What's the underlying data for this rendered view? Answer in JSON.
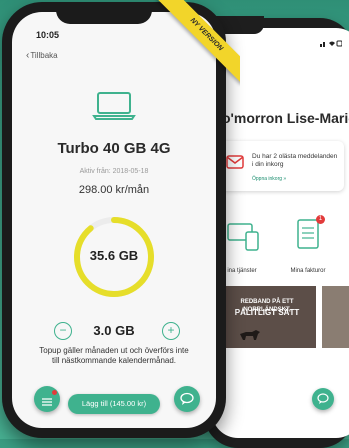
{
  "colors": {
    "accent": "#3fb28e",
    "gauge_track": "#ececec",
    "gauge_fill": "#e6de2a",
    "ribbon": "#f2d52a",
    "alert": "#e23b3b"
  },
  "ribbon": {
    "label": "NY VERSION"
  },
  "front": {
    "status_time": "10:05",
    "back_label": "Tillbaka",
    "plan_icon": "laptop-icon",
    "plan_title": "Turbo 40 GB 4G",
    "active_from": "Aktiv från: 2018-05-18",
    "price": "298.00 kr/mån",
    "gauge": {
      "value_label": "35.6 GB",
      "fill_fraction": 0.89
    },
    "stepper": {
      "minus": "−",
      "value": "3.0 GB",
      "plus": "+"
    },
    "topup_note": "Topup gäller månaden ut och överförs inte till nästkommande kalendermånad.",
    "add_button": "Lägg till (145.00 kr)"
  },
  "back": {
    "greeting": "o'morron Lise-Marie",
    "message_text": "Du har 2 olästa meddelanden i din inkorg",
    "message_link": "Öppna inkorg »",
    "tile_services": "ina tjänster",
    "tile_invoices": "Mina fakturor",
    "invoice_badge": "1",
    "banner_top": "REDBAND PÅ ETT NORRLÄNDSKT,",
    "banner_bottom": "PÅLITLIGT SÄTT"
  }
}
